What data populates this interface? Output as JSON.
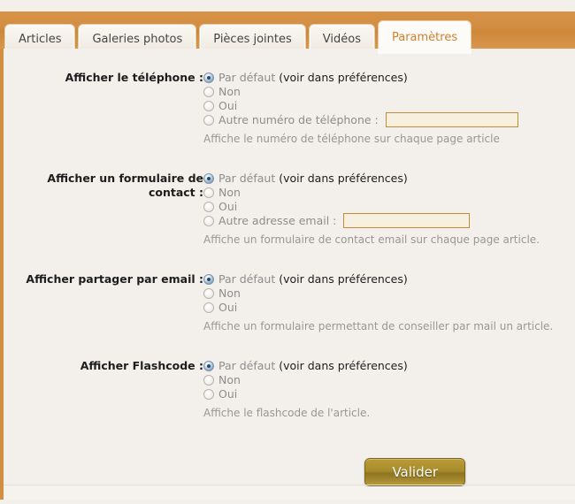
{
  "tabs": [
    {
      "label": "Articles",
      "active": false
    },
    {
      "label": "Galeries photos",
      "active": false
    },
    {
      "label": "Pièces jointes",
      "active": false
    },
    {
      "label": "Vidéos",
      "active": false
    },
    {
      "label": "Paramètres",
      "active": true
    }
  ],
  "colors": {
    "accent_orange": "#d28e43",
    "active_tab_text": "#cf7f2e",
    "button_gold": "#a98d2c",
    "input_bg": "#f7f0de",
    "input_border": "#bf8c3e",
    "help_text": "#999693",
    "page_bg": "#f3f0ec"
  },
  "sections": [
    {
      "label": "Afficher le téléphone :",
      "options": [
        {
          "text_gray": "Par défaut ",
          "text_dark": "(voir dans préférences)",
          "checked": true
        },
        {
          "text_gray": "Non",
          "text_dark": "",
          "checked": false
        },
        {
          "text_gray": "Oui",
          "text_dark": "",
          "checked": false
        },
        {
          "text_gray": "Autre numéro de téléphone :",
          "text_dark": "",
          "checked": false,
          "input": {
            "value": "",
            "placeholder": ""
          }
        }
      ],
      "help": "Affiche le numéro de téléphone sur chaque page article"
    },
    {
      "label": "Afficher un formulaire de contact :",
      "options": [
        {
          "text_gray": "Par défaut ",
          "text_dark": "(voir dans préférences)",
          "checked": true
        },
        {
          "text_gray": "Non",
          "text_dark": "",
          "checked": false
        },
        {
          "text_gray": "Oui",
          "text_dark": "",
          "checked": false
        },
        {
          "text_gray": "Autre adresse email :",
          "text_dark": "",
          "checked": false,
          "input": {
            "value": "",
            "placeholder": ""
          }
        }
      ],
      "help": "Affiche un formulaire de contact email sur chaque page article."
    },
    {
      "label": "Afficher partager par email :",
      "options": [
        {
          "text_gray": "Par défaut ",
          "text_dark": "(voir dans préférences)",
          "checked": true
        },
        {
          "text_gray": "Non",
          "text_dark": "",
          "checked": false
        },
        {
          "text_gray": "Oui",
          "text_dark": "",
          "checked": false
        }
      ],
      "help": "Affiche un formulaire permettant de conseiller par mail un article."
    },
    {
      "label": "Afficher Flashcode :",
      "options": [
        {
          "text_gray": "Par défaut ",
          "text_dark": "(voir dans préférences)",
          "checked": true
        },
        {
          "text_gray": "Non",
          "text_dark": "",
          "checked": false
        },
        {
          "text_gray": "Oui",
          "text_dark": "",
          "checked": false
        }
      ],
      "help": "Affiche le flashcode de l'article."
    }
  ],
  "submit": {
    "label": "Valider"
  }
}
